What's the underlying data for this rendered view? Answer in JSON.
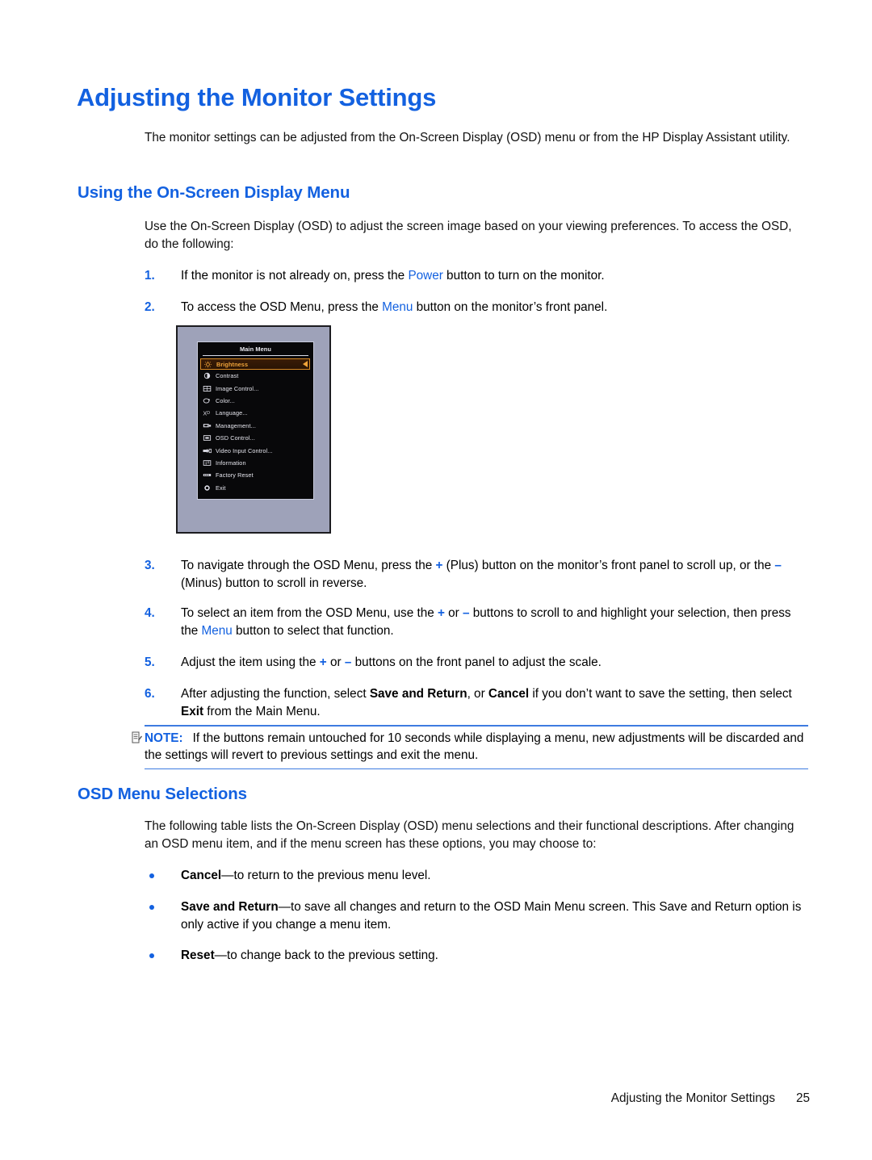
{
  "page": {
    "title": "Adjusting the Monitor Settings",
    "intro": "The monitor settings can be adjusted from the On-Screen Display (OSD) menu or from the HP Display Assistant utility.",
    "accent_blue": "#1361E0",
    "footer": {
      "chapter": "Adjusting the Monitor Settings",
      "page_number": "25"
    }
  },
  "section_osd": {
    "heading": "Using the On-Screen Display Menu",
    "intro": "Use the On-Screen Display (OSD) to adjust the screen image based on your viewing preferences. To access the OSD, do the following:",
    "steps": [
      {
        "num": "1.",
        "text_before": "If the monitor is not already on, press the ",
        "link": "Power",
        "text_after": " button to turn on the monitor."
      },
      {
        "num": "2.",
        "text_before": "To access the OSD Menu, press the ",
        "link": "Menu",
        "text_after": " button on the monitor’s front panel."
      },
      {
        "num": "3.",
        "part1": "To navigate through the OSD Menu, press the ",
        "sym1": "+",
        "part2": " (Plus) button on the monitor’s front panel to scroll up, or the ",
        "sym2": "–",
        "part3": " (Minus) button to scroll in reverse."
      },
      {
        "num": "4.",
        "part1": "To select an item from the OSD Menu, use the ",
        "sym1": "+",
        "part2": " or ",
        "sym2": "–",
        "part3": " buttons to scroll to and highlight your selection, then press the ",
        "link": "Menu",
        "part4": " button to select that function."
      },
      {
        "num": "5.",
        "part1": "Adjust the item using the ",
        "sym1": "+",
        "part2": " or ",
        "sym2": "–",
        "part3": " buttons on the front panel to adjust the scale."
      },
      {
        "num": "6.",
        "part1": "After adjusting the function, select ",
        "bold1": "Save and Return",
        "part2": ", or ",
        "bold2": "Cancel",
        "part3": " if you don’t want to save the setting, then select ",
        "bold3": "Exit",
        "part4": " from the Main Menu."
      }
    ],
    "note": {
      "keyword": "NOTE:",
      "text": "If the buttons remain untouched for 10 seconds while displaying a menu, new adjustments will be discarded and the settings will revert to previous settings and exit the menu."
    }
  },
  "osd_figure": {
    "menu_title": "Main Menu",
    "items": [
      {
        "label": "Brightness",
        "icon": "brightness-icon",
        "selected": true
      },
      {
        "label": "Contrast",
        "icon": "contrast-icon",
        "selected": false
      },
      {
        "label": "Image Control...",
        "icon": "image-control-icon",
        "selected": false
      },
      {
        "label": "Color...",
        "icon": "color-icon",
        "selected": false
      },
      {
        "label": "Language...",
        "icon": "language-icon",
        "selected": false
      },
      {
        "label": "Management...",
        "icon": "management-icon",
        "selected": false
      },
      {
        "label": "OSD Control...",
        "icon": "osd-control-icon",
        "selected": false
      },
      {
        "label": "Video Input Control...",
        "icon": "video-input-icon",
        "selected": false
      },
      {
        "label": "Information",
        "icon": "information-icon",
        "selected": false
      },
      {
        "label": "Factory Reset",
        "icon": "factory-reset-icon",
        "selected": false
      },
      {
        "label": "Exit",
        "icon": "exit-icon",
        "selected": false
      }
    ],
    "highlight_color": "#F0A43A",
    "bezel_color": "#9EA2B9"
  },
  "section_selections": {
    "heading": "OSD Menu Selections",
    "intro": "The following table lists the On-Screen Display (OSD) menu selections and their functional descriptions. After changing an OSD menu item, and if the menu screen has these options, you may choose to:",
    "bullets": [
      {
        "term": "Cancel",
        "text": "—to return to the previous menu level."
      },
      {
        "term": "Save and Return",
        "text": "—to save all changes and return to the OSD Main Menu screen. This Save and Return option is only active if you change a menu item."
      },
      {
        "term": "Reset",
        "text": "—to change back to the previous setting."
      }
    ]
  }
}
